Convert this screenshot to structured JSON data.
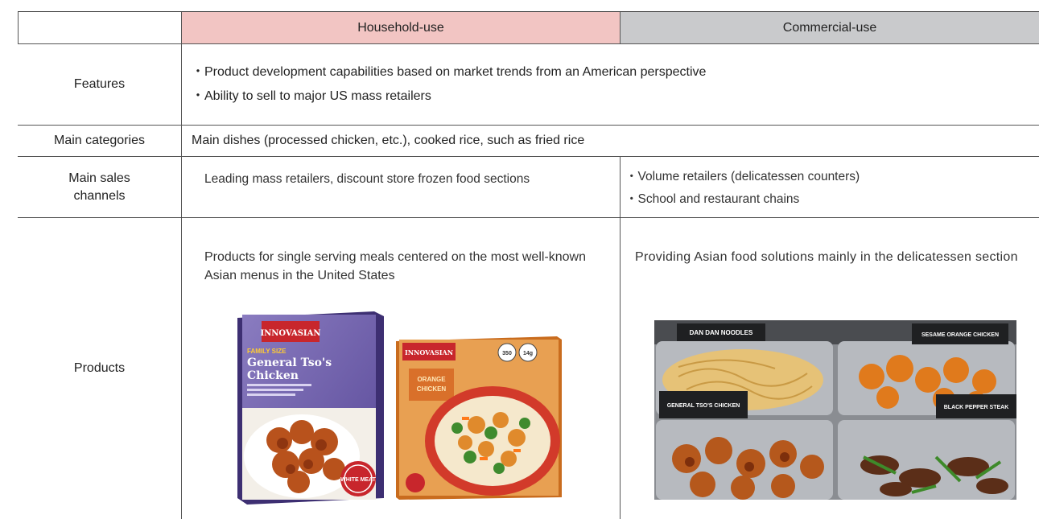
{
  "header": {
    "household": "Household-use",
    "commercial": "Commercial-use"
  },
  "rows": {
    "features": {
      "label": "Features",
      "items": [
        "・Product development capabilities based on market trends from an American perspective",
        "・Ability to sell to major US mass retailers"
      ]
    },
    "categories": {
      "label": "Main categories",
      "text": "Main dishes (processed chicken, etc.), cooked rice, such as fried rice"
    },
    "channels": {
      "label_line1": "Main sales",
      "label_line2": "channels",
      "household": "Leading mass retailers, discount store frozen food sections",
      "commercial": [
        "・Volume retailers (delicatessen counters)",
        "・School and restaurant chains"
      ]
    },
    "products": {
      "label": "Products",
      "household": "Products for single serving meals centered on the most well-known Asian menus in the United States",
      "commercial": "Providing Asian food solutions mainly in the delicatessen section"
    }
  },
  "images": {
    "box1": {
      "brand": "INNOVASIAN",
      "line1": "FAMILY SIZE",
      "line2": "General Tso's",
      "line3": "Chicken",
      "seal": "WHITE MEAT"
    },
    "box2": {
      "brand": "INNOVASIAN",
      "badge1": "350",
      "badge2": "14g",
      "line1": "ORANGE",
      "line2": "CHICKEN"
    },
    "deli": {
      "sign1": "DAN DAN NOODLES",
      "sign2": "SESAME ORANGE CHICKEN",
      "sign3": "GENERAL TSO'S CHICKEN",
      "sign4": "BLACK PEPPER STEAK"
    }
  }
}
